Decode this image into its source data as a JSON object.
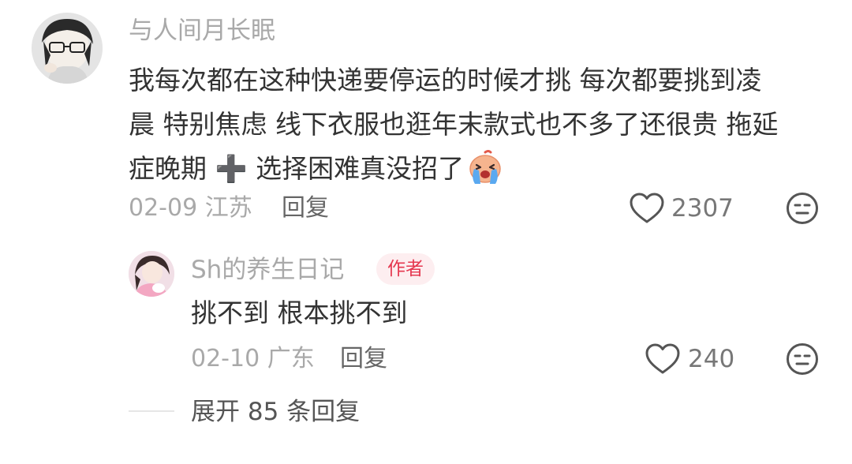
{
  "comment": {
    "author": "与人间月长眠",
    "text_lines": [
      "我每次都在这种快递要停运的时候才挑 每次都要挑到凌",
      "晨 特别焦虑 线下衣服也逛年末款式也不多了还很贵 拖延",
      "症晚期 ➕ 选择困难真没招了"
    ],
    "date_location": "02-09 江苏",
    "reply_label": "回复",
    "like_count": "2307",
    "icons": {
      "avatar": "user-avatar",
      "emoji": "crying-face-emoji",
      "like": "heart-outline-icon",
      "dislike": "unamused-face-icon"
    }
  },
  "reply": {
    "author": "Sh的养生日记",
    "badge": "作者",
    "text": "挑不到 根本挑不到",
    "date_location": "02-10 广东",
    "reply_label": "回复",
    "like_count": "240",
    "icons": {
      "avatar": "user-avatar",
      "like": "heart-outline-icon",
      "dislike": "unamused-face-icon"
    }
  },
  "expand": {
    "label": "展开 85 条回复"
  },
  "colors": {
    "text_primary": "#333333",
    "text_secondary": "#a9a9a9",
    "author_badge_text": "#e5374f",
    "author_badge_bg": "#fdeef0"
  }
}
